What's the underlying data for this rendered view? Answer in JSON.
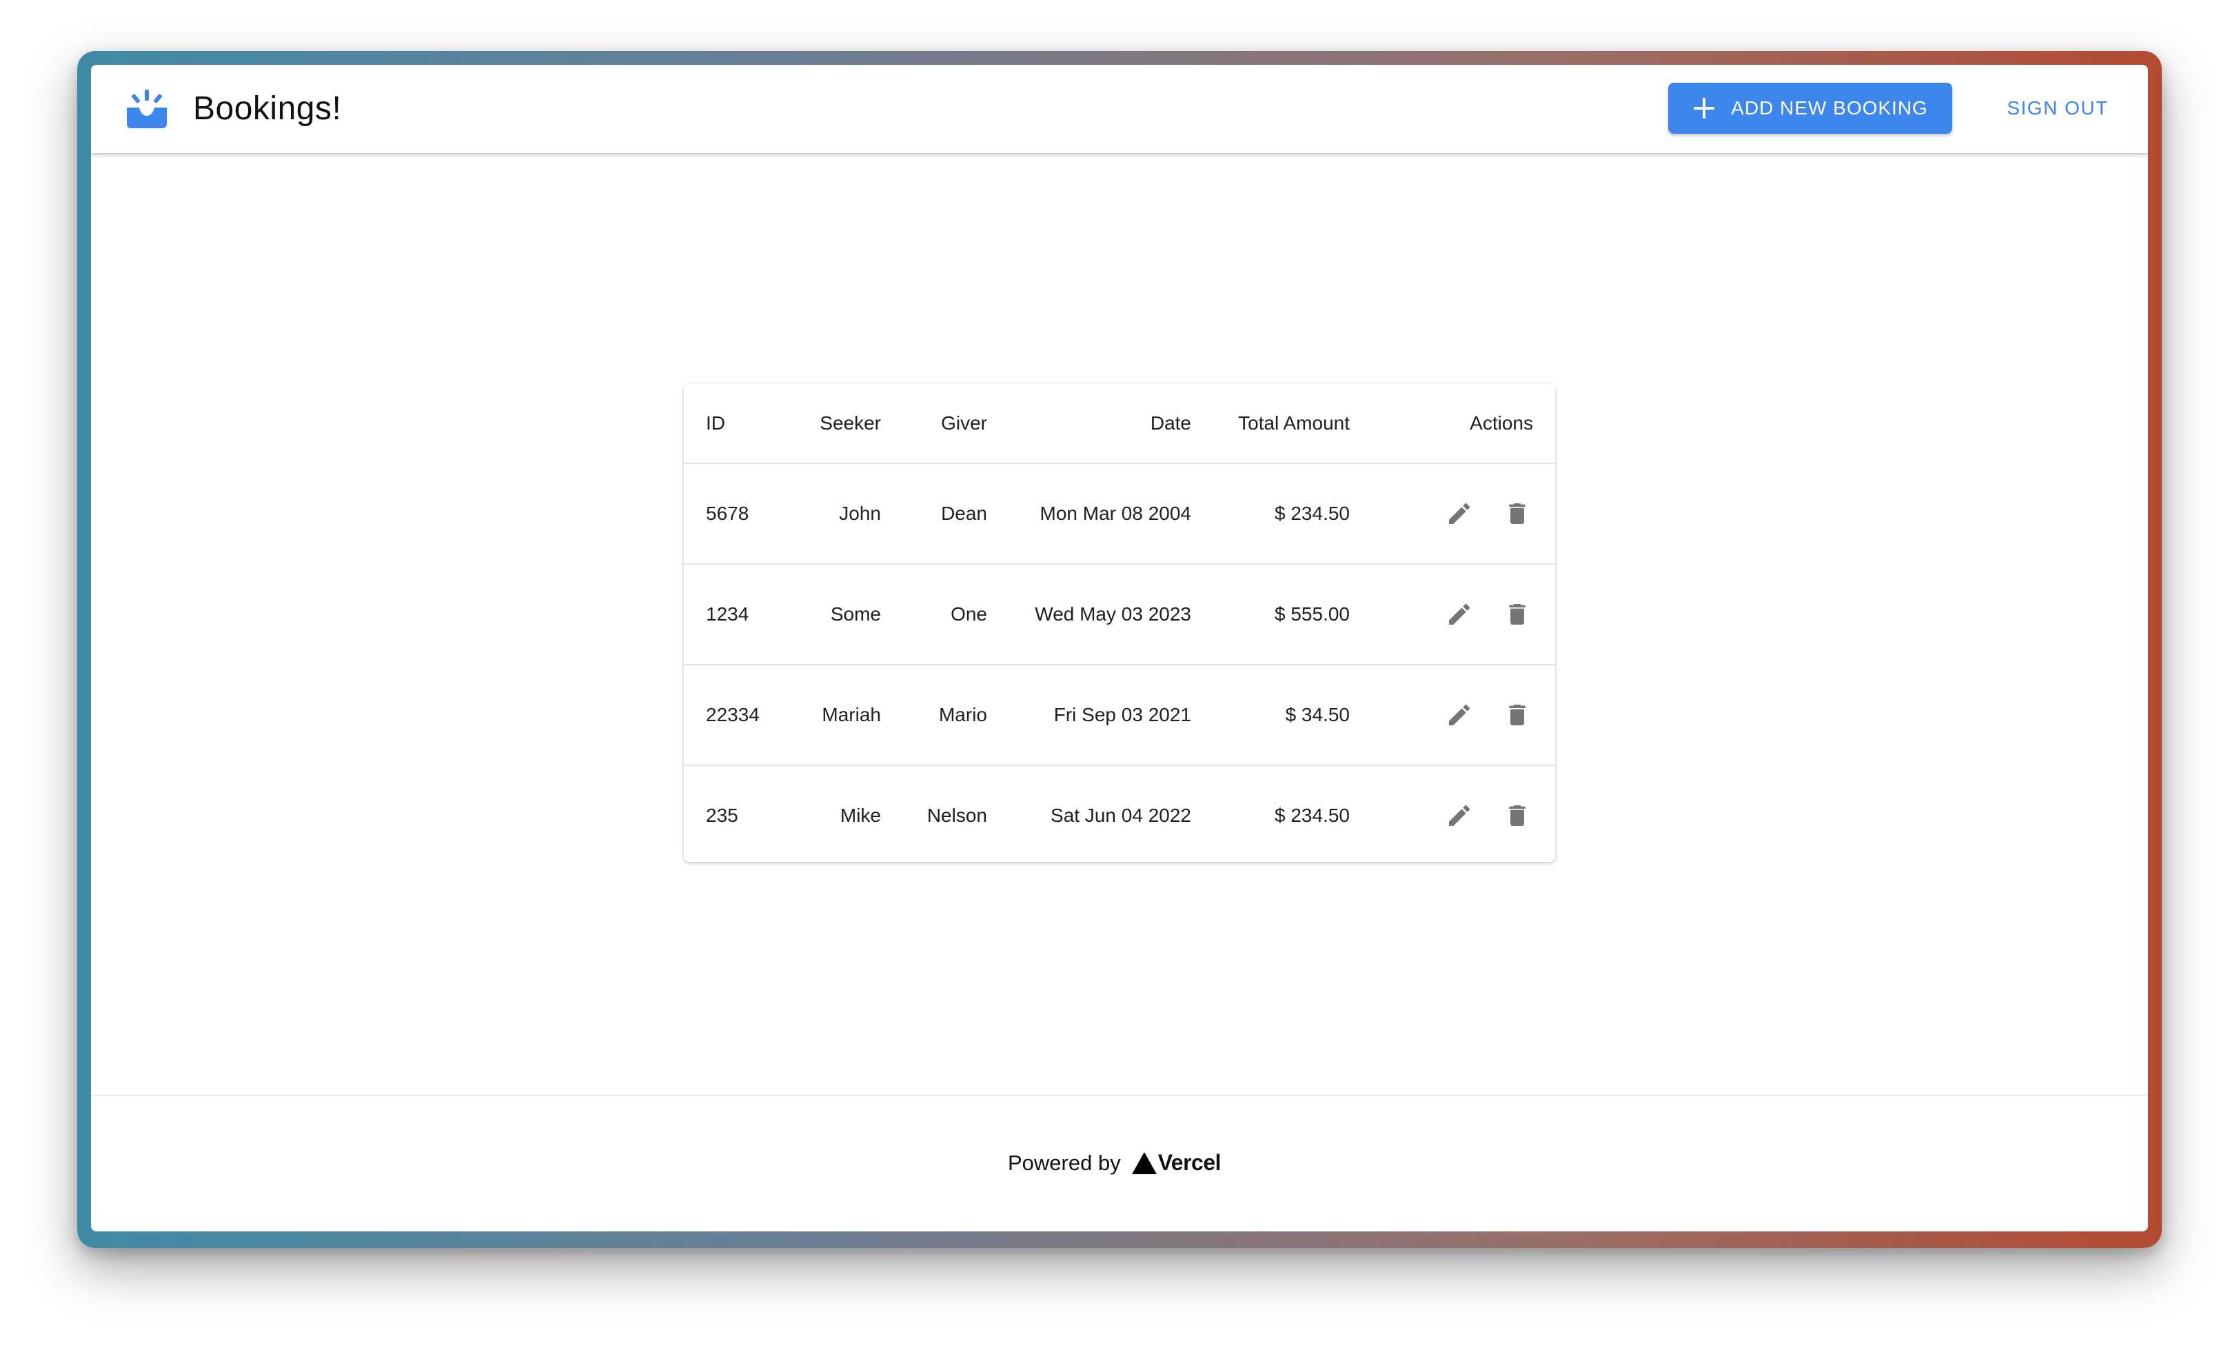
{
  "header": {
    "title": "Bookings!",
    "add_button_label": "ADD NEW BOOKING",
    "sign_out_label": "SIGN OUT",
    "icons": {
      "logo": "inbox-icon",
      "add": "plus-icon"
    }
  },
  "table": {
    "columns": {
      "id": "ID",
      "seeker": "Seeker",
      "giver": "Giver",
      "date": "Date",
      "total": "Total Amount",
      "actions": "Actions"
    },
    "rows": [
      {
        "id": "5678",
        "seeker": "John",
        "giver": "Dean",
        "date": "Mon Mar 08 2004",
        "total": "$ 234.50"
      },
      {
        "id": "1234",
        "seeker": "Some",
        "giver": "One",
        "date": "Wed May 03 2023",
        "total": "$ 555.00"
      },
      {
        "id": "22334",
        "seeker": "Mariah",
        "giver": "Mario",
        "date": "Fri Sep 03 2021",
        "total": "$ 34.50"
      },
      {
        "id": "235",
        "seeker": "Mike",
        "giver": "Nelson",
        "date": "Sat Jun 04 2022",
        "total": "$ 234.50"
      }
    ],
    "row_action_icons": [
      "edit-icon",
      "delete-icon"
    ]
  },
  "footer": {
    "powered_by": "Powered by",
    "vercel_wordmark": "Vercel"
  },
  "colors": {
    "accent": "#3c86ec",
    "icon_gray": "#757575"
  }
}
